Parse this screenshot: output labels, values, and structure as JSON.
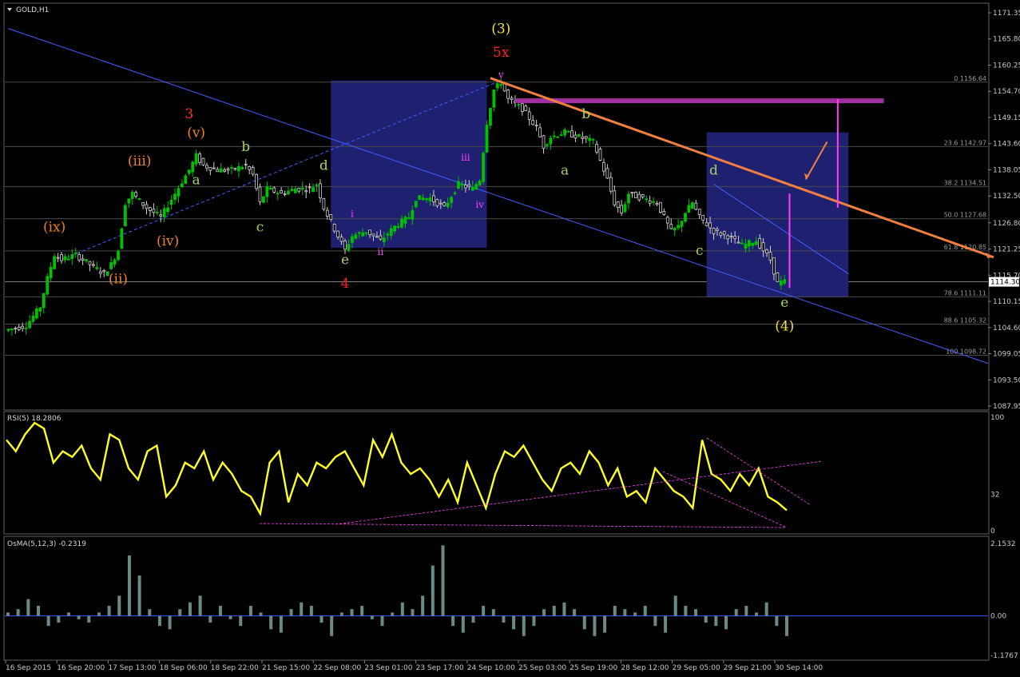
{
  "window": {
    "title": "GOLD,H1"
  },
  "chart_data": [
    {
      "type": "candlestick",
      "symbol": "GOLD",
      "timeframe": "H1",
      "title": "GOLD,H1",
      "current_price": "1114.30",
      "ylim": [
        1087.95,
        1171.35
      ],
      "y_ticks": [
        "1171.35",
        "1165.80",
        "1160.25",
        "1154.70",
        "1149.15",
        "1143.60",
        "1138.05",
        "1132.50",
        "1126.80",
        "1121.25",
        "1115.70",
        "1110.15",
        "1104.60",
        "1099.05",
        "1093.50",
        "1087.95"
      ],
      "x_ticks": [
        "16 Sep 2015",
        "16 Sep 20:00",
        "17 Sep 13:00",
        "18 Sep 06:00",
        "18 Sep 22:00",
        "21 Sep 15:00",
        "22 Sep 08:00",
        "23 Sep 01:00",
        "23 Sep 17:00",
        "24 Sep 10:00",
        "25 Sep 03:00",
        "25 Sep 19:00",
        "28 Sep 12:00",
        "29 Sep 05:00",
        "29 Sep 21:00",
        "30 Sep 14:00"
      ],
      "price_path": [
        [
          0,
          1104
        ],
        [
          3,
          1105
        ],
        [
          5,
          1109
        ],
        [
          6,
          1115
        ],
        [
          7,
          1120
        ],
        [
          8,
          1119
        ],
        [
          10,
          1120
        ],
        [
          12,
          1118
        ],
        [
          14,
          1116
        ],
        [
          15,
          1118
        ],
        [
          16,
          1121
        ],
        [
          17,
          1131
        ],
        [
          18,
          1133
        ],
        [
          20,
          1130
        ],
        [
          22,
          1128
        ],
        [
          24,
          1133
        ],
        [
          26,
          1138
        ],
        [
          27,
          1141
        ],
        [
          28,
          1139
        ],
        [
          30,
          1138
        ],
        [
          32,
          1138
        ],
        [
          34,
          1139
        ],
        [
          35,
          1137
        ],
        [
          36,
          1131
        ],
        [
          37,
          1134
        ],
        [
          39,
          1133
        ],
        [
          41,
          1134
        ],
        [
          43,
          1134
        ],
        [
          44,
          1135
        ],
        [
          45,
          1130
        ],
        [
          47,
          1124
        ],
        [
          48,
          1121
        ],
        [
          49,
          1124
        ],
        [
          51,
          1125
        ],
        [
          53,
          1123
        ],
        [
          55,
          1126
        ],
        [
          57,
          1128
        ],
        [
          58,
          1132
        ],
        [
          60,
          1132
        ],
        [
          62,
          1130
        ],
        [
          64,
          1135
        ],
        [
          66,
          1134
        ],
        [
          67,
          1136
        ],
        [
          68,
          1148
        ],
        [
          69,
          1155
        ],
        [
          70,
          1156.6
        ],
        [
          71,
          1153
        ],
        [
          73,
          1151
        ],
        [
          75,
          1147
        ],
        [
          76,
          1143
        ],
        [
          77,
          1145
        ],
        [
          79,
          1146
        ],
        [
          81,
          1145
        ],
        [
          83,
          1144
        ],
        [
          85,
          1136
        ],
        [
          86,
          1131
        ],
        [
          87,
          1129
        ],
        [
          88,
          1133
        ],
        [
          90,
          1132
        ],
        [
          92,
          1131
        ],
        [
          94,
          1125
        ],
        [
          95,
          1126
        ],
        [
          96,
          1129
        ],
        [
          97,
          1131
        ],
        [
          98,
          1128
        ],
        [
          100,
          1125
        ],
        [
          102,
          1124
        ],
        [
          104,
          1122
        ],
        [
          106,
          1123
        ],
        [
          108,
          1119
        ],
        [
          109,
          1114
        ],
        [
          110,
          1114.3
        ]
      ],
      "fib_levels": [
        {
          "label": "0 1156.64",
          "value": 1156.64
        },
        {
          "label": "23.6 1142.97",
          "value": 1142.97
        },
        {
          "label": "38.2 1134.51",
          "value": 1134.51
        },
        {
          "label": "50.0 1127.68",
          "value": 1127.68
        },
        {
          "label": "61.8 1120.85",
          "value": 1120.85
        },
        {
          "label": "78.6 1111.11",
          "value": 1111.11
        },
        {
          "label": "88.6 1105.32",
          "value": 1105.32
        },
        {
          "label": "100 1098.72",
          "value": 1098.72
        }
      ],
      "wave_labels": [
        {
          "text": "(3)",
          "color": "#f0e040",
          "t": 70,
          "p": 1167
        },
        {
          "text": "5x",
          "color": "#ff2020",
          "t": 70,
          "p": 1162
        },
        {
          "text": "v",
          "color": "#ff40ff",
          "t": 70,
          "p": 1157.5,
          "small": true
        },
        {
          "text": "3",
          "color": "#ff3030",
          "t": 26,
          "p": 1149
        },
        {
          "text": "(v)",
          "color": "#f08020",
          "t": 27,
          "p": 1145
        },
        {
          "text": "(iii)",
          "color": "#f08020",
          "t": 19,
          "p": 1139
        },
        {
          "text": "(ix)",
          "color": "#f08020",
          "t": 7,
          "p": 1125
        },
        {
          "text": "(iv)",
          "color": "#f08020",
          "t": 23,
          "p": 1122
        },
        {
          "text": "(ii)",
          "color": "#f08020",
          "t": 16,
          "p": 1114
        },
        {
          "text": "a",
          "color": "#a8d060",
          "t": 27,
          "p": 1135
        },
        {
          "text": "b",
          "color": "#a8d060",
          "t": 34,
          "p": 1142
        },
        {
          "text": "c",
          "color": "#a8d060",
          "t": 36,
          "p": 1125
        },
        {
          "text": "d",
          "color": "#a8d060",
          "t": 45,
          "p": 1138
        },
        {
          "text": "e",
          "color": "#a8d060",
          "t": 48,
          "p": 1118
        },
        {
          "text": "4",
          "color": "#ff2020",
          "t": 48,
          "p": 1113
        },
        {
          "text": "i",
          "color": "#ff40ff",
          "t": 49,
          "p": 1128,
          "small": true
        },
        {
          "text": "ii",
          "color": "#ff40ff",
          "t": 53,
          "p": 1120,
          "small": true
        },
        {
          "text": "iii",
          "color": "#ff40ff",
          "t": 65,
          "p": 1140,
          "small": true
        },
        {
          "text": "iv",
          "color": "#ff40ff",
          "t": 67,
          "p": 1130,
          "small": true
        },
        {
          "text": "b",
          "color": "#a8d060",
          "t": 82,
          "p": 1149
        },
        {
          "text": "a",
          "color": "#a8d060",
          "t": 79,
          "p": 1137
        },
        {
          "text": "d",
          "color": "#a8d060",
          "t": 100,
          "p": 1137
        },
        {
          "text": "c",
          "color": "#a8d060",
          "t": 98,
          "p": 1120
        },
        {
          "text": "e",
          "color": "#a8d060",
          "t": 110,
          "p": 1109
        },
        {
          "text": "(4)",
          "color": "#f0e040",
          "t": 110,
          "p": 1104
        }
      ],
      "colors": {
        "bull": "#00c000",
        "bear": "#d0d0d0",
        "grid": "#303030",
        "trend": "#4060ff",
        "orange": "#f08040",
        "magenta": "#ff40ff",
        "purple_bar": "#a030a0",
        "box": "#202070"
      }
    },
    {
      "type": "line",
      "indicator": "RSI",
      "title": "RSI(5) 18.2806",
      "ylim": [
        0,
        100
      ],
      "y_ticks": [
        "100",
        "32",
        "0"
      ],
      "values": [
        80,
        70,
        85,
        95,
        90,
        60,
        70,
        65,
        75,
        55,
        45,
        85,
        80,
        55,
        45,
        70,
        75,
        30,
        40,
        60,
        55,
        70,
        45,
        60,
        50,
        35,
        30,
        15,
        60,
        70,
        25,
        50,
        40,
        60,
        55,
        65,
        70,
        55,
        40,
        80,
        65,
        85,
        60,
        50,
        55,
        45,
        30,
        45,
        25,
        60,
        40,
        20,
        50,
        70,
        65,
        75,
        60,
        45,
        35,
        55,
        60,
        50,
        70,
        60,
        40,
        55,
        30,
        35,
        25,
        55,
        45,
        35,
        30,
        20,
        80,
        50,
        45,
        35,
        50,
        40,
        55,
        30,
        25,
        18
      ]
    },
    {
      "type": "bar",
      "indicator": "OsMA",
      "title": "OsMA(5,12,3) -0.2319",
      "ylim": [
        -1.1767,
        2.1532
      ],
      "y_ticks": [
        "2.1532",
        "0.00",
        "-1.1767"
      ],
      "values": [
        0.1,
        0.2,
        0.5,
        0.3,
        -0.3,
        -0.2,
        0.1,
        -0.1,
        -0.2,
        0.1,
        0.3,
        0.6,
        1.8,
        1.2,
        0.2,
        -0.3,
        -0.4,
        0.2,
        0.4,
        0.6,
        -0.2,
        0.3,
        -0.1,
        -0.3,
        0.3,
        0.1,
        -0.4,
        -0.5,
        0.2,
        0.4,
        0.3,
        -0.2,
        -0.6,
        0.1,
        0.2,
        0.3,
        -0.1,
        -0.3,
        0.1,
        0.4,
        0.2,
        0.6,
        1.5,
        2.1,
        -0.3,
        -0.5,
        -0.2,
        0.3,
        0.2,
        -0.2,
        -0.4,
        -0.6,
        -0.3,
        0.2,
        0.3,
        0.4,
        0.2,
        -0.4,
        -0.6,
        -0.5,
        0.3,
        0.2,
        0.1,
        0.3,
        -0.3,
        -0.5,
        0.6,
        0.3,
        0.2,
        -0.2,
        -0.3,
        -0.4,
        0.2,
        0.3,
        0.1,
        0.4,
        -0.3,
        -0.6
      ]
    }
  ]
}
